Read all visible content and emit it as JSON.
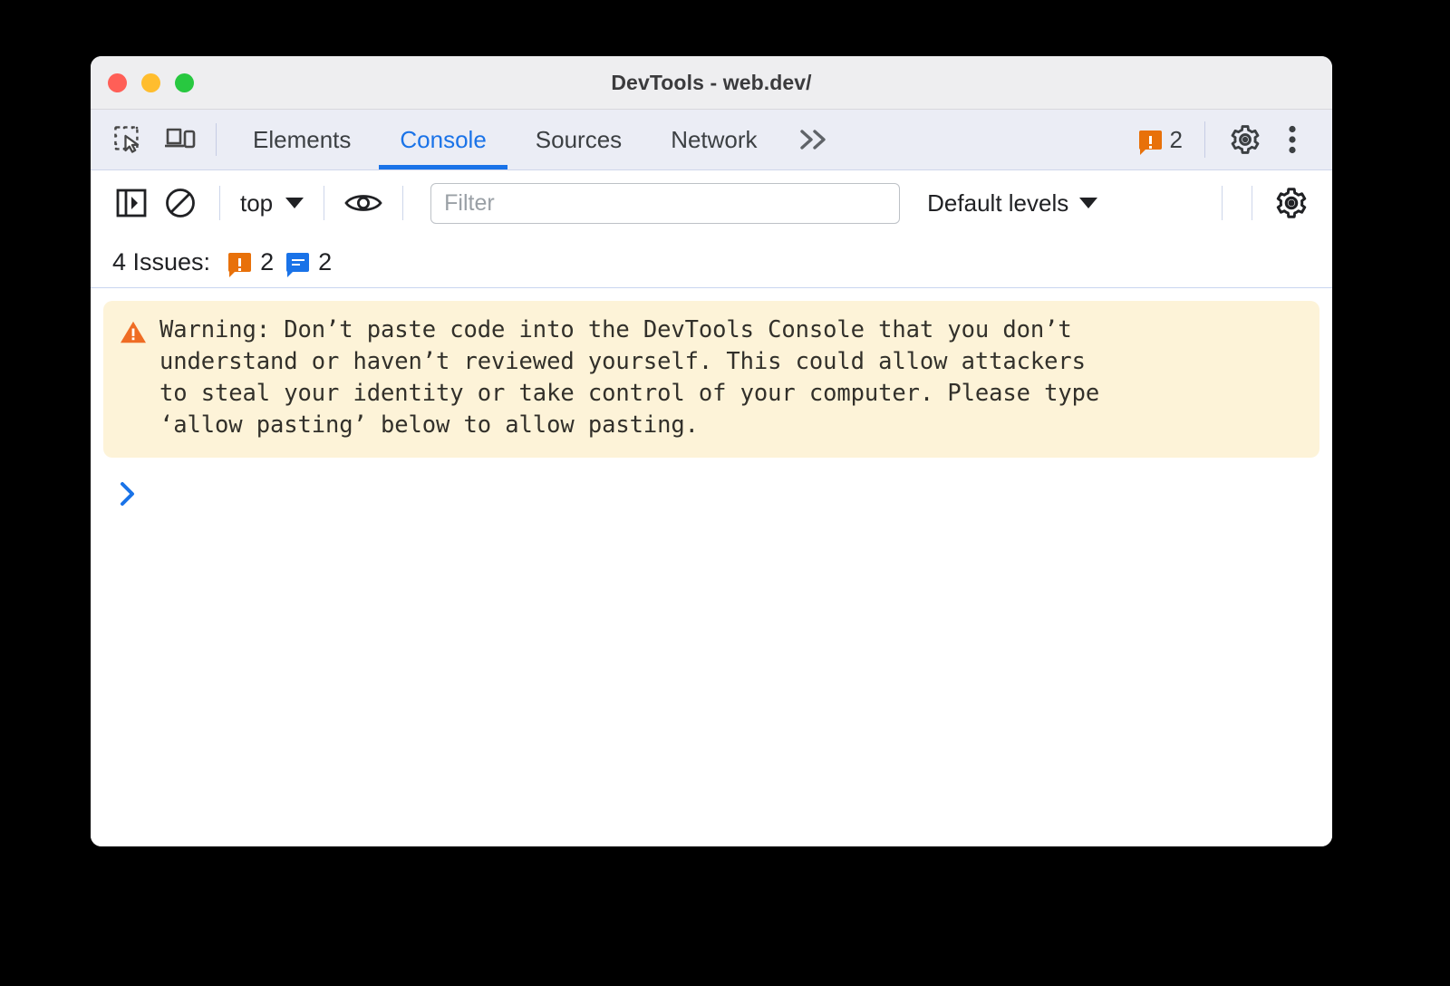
{
  "window": {
    "title": "DevTools - web.dev/",
    "traffic_lights": [
      {
        "name": "close",
        "color": "#ff5f57"
      },
      {
        "name": "minimize",
        "color": "#ffbd2e"
      },
      {
        "name": "maximize",
        "color": "#28c840"
      }
    ]
  },
  "tabbar": {
    "inspect_icon": "inspect-element-icon",
    "device_icon": "device-toolbar-icon",
    "tabs": [
      {
        "label": "Elements",
        "active": false
      },
      {
        "label": "Console",
        "active": true
      },
      {
        "label": "Sources",
        "active": false
      },
      {
        "label": "Network",
        "active": false
      }
    ],
    "more_tabs": "»",
    "issue_badge_count": "2",
    "settings_icon": "gear-icon",
    "more_options_icon": "more-vertical-icon",
    "accent_color": "#1a73e8",
    "warning_color": "#e8710a"
  },
  "console_toolbar": {
    "sidebar_toggle_icon": "console-sidebar-icon",
    "clear_console_icon": "clear-console-icon",
    "context_selector": "top",
    "live_expression_icon": "eye-icon",
    "filter_placeholder": "Filter",
    "filter_value": "",
    "log_levels": "Default levels",
    "settings_icon": "gear-icon"
  },
  "issues_bar": {
    "label": "4 Issues:",
    "warning_count": "2",
    "info_count": "2"
  },
  "console": {
    "warning_icon": "warning-triangle-icon",
    "warning_text": "Warning: Don’t paste code into the DevTools Console that you don’t\nunderstand or haven’t reviewed yourself. This could allow attackers\nto steal your identity or take control of your computer. Please type\n‘allow pasting’ below to allow pasting.",
    "warning_bg": "#fdf3d8",
    "prompt_icon": "prompt-chevron-icon",
    "prompt_value": ""
  }
}
